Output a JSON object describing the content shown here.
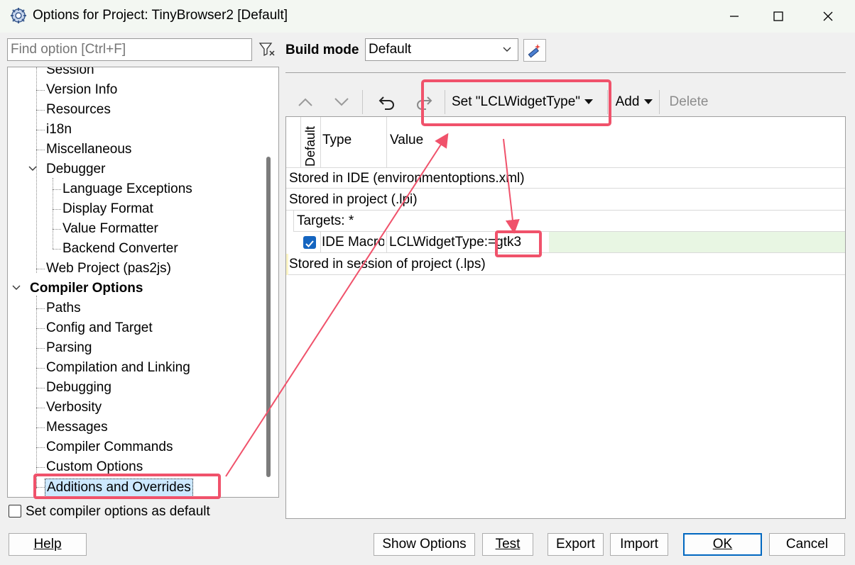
{
  "window": {
    "title": "Options for Project: TinyBrowser2 [Default]"
  },
  "search": {
    "placeholder": "Find option [Ctrl+F]"
  },
  "build_mode": {
    "label": "Build mode",
    "value": "Default"
  },
  "tree": {
    "items": [
      {
        "label": "Session",
        "level": 1
      },
      {
        "label": "Version Info",
        "level": 1
      },
      {
        "label": "Resources",
        "level": 1
      },
      {
        "label": "i18n",
        "level": 1
      },
      {
        "label": "Miscellaneous",
        "level": 1
      },
      {
        "label": "Debugger",
        "level": 1,
        "expanded": true
      },
      {
        "label": "Language Exceptions",
        "level": 2
      },
      {
        "label": "Display Format",
        "level": 2
      },
      {
        "label": "Value Formatter",
        "level": 2
      },
      {
        "label": "Backend Converter",
        "level": 2
      },
      {
        "label": "Web Project (pas2js)",
        "level": 1
      },
      {
        "label": "Compiler Options",
        "level": 0,
        "expanded": true
      },
      {
        "label": "Paths",
        "level": 1
      },
      {
        "label": "Config and Target",
        "level": 1
      },
      {
        "label": "Parsing",
        "level": 1
      },
      {
        "label": "Compilation and Linking",
        "level": 1
      },
      {
        "label": "Debugging",
        "level": 1
      },
      {
        "label": "Verbosity",
        "level": 1
      },
      {
        "label": "Messages",
        "level": 1
      },
      {
        "label": "Compiler Commands",
        "level": 1
      },
      {
        "label": "Custom Options",
        "level": 1
      },
      {
        "label": "Additions and Overrides",
        "level": 1,
        "selected": true
      }
    ]
  },
  "set_default": {
    "label": "Set compiler options as default",
    "checked": false
  },
  "toolbar": {
    "set_label": "Set \"LCLWidgetType\"",
    "add_label": "Add",
    "delete_label": "Delete"
  },
  "grid": {
    "headers": {
      "default": "Default",
      "type": "Type",
      "value": "Value"
    },
    "rows": {
      "ide": "Stored in IDE (environmentoptions.xml)",
      "project": "Stored in project (.lpi)",
      "targets": "Targets: *",
      "macro_type": "IDE Macro",
      "macro_value": "LCLWidgetType:=gtk3",
      "session": "Stored in session of project (.lps)"
    }
  },
  "buttons": {
    "help": "Help",
    "show_options": "Show Options",
    "test": "Test",
    "export": "Export",
    "import": "Import",
    "ok": "OK",
    "cancel": "Cancel"
  },
  "colors": {
    "annotation": "#f0526b",
    "selection": "#cce8ff",
    "check_accent": "#1565c0"
  },
  "icons": {
    "app": "gear-icon",
    "filter": "filter-clear-icon",
    "tool": "wand-icon",
    "up": "chevron-up-icon",
    "down": "chevron-down-icon",
    "undo": "undo-icon",
    "redo": "redo-icon"
  }
}
